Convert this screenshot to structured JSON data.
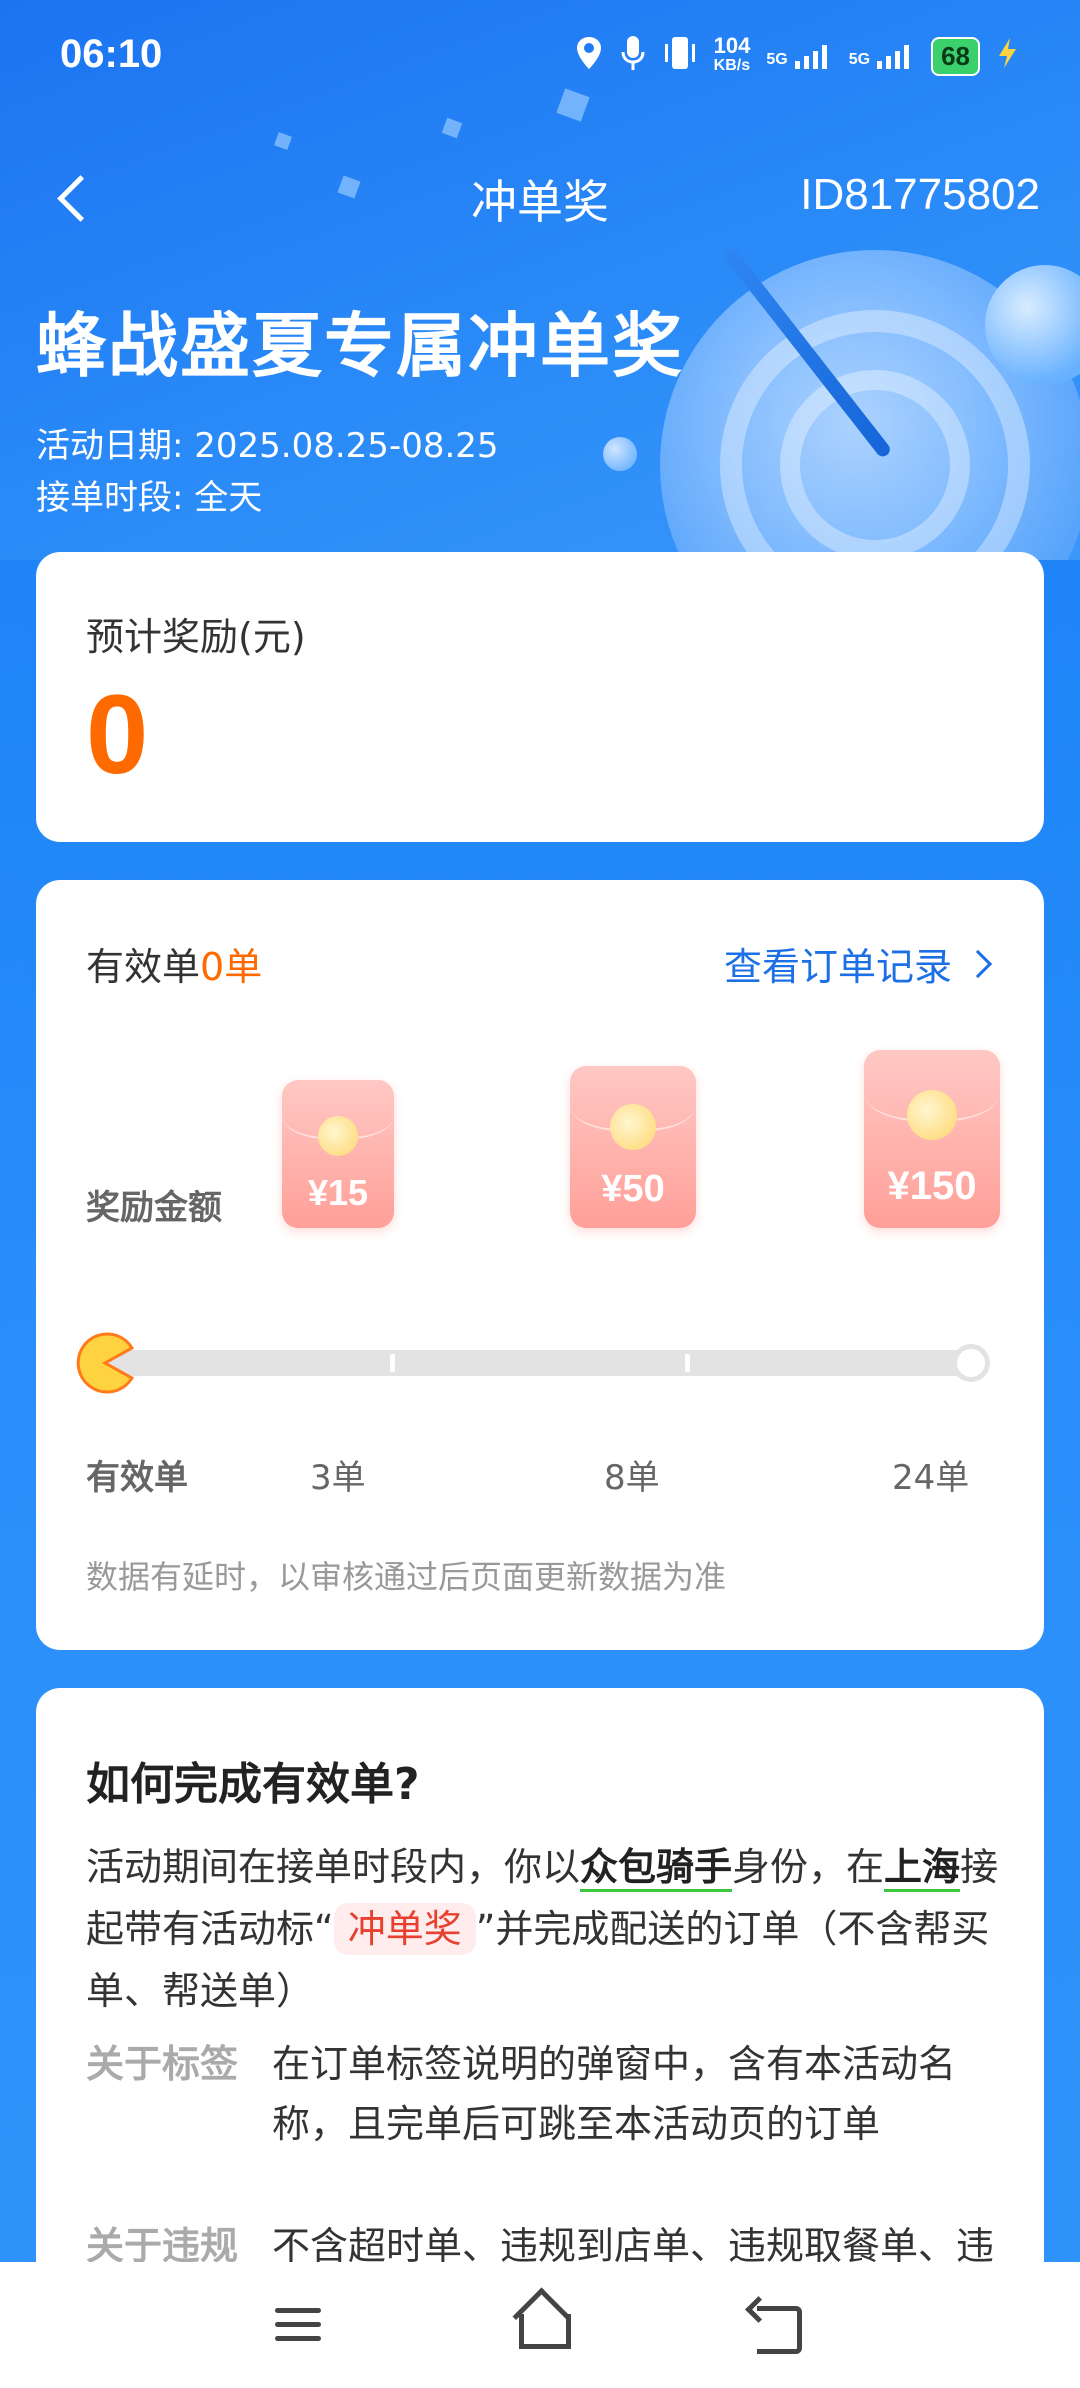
{
  "status_bar": {
    "time": "06:10",
    "net_speed": "104",
    "net_speed_unit": "KB/s",
    "signal1": "5G",
    "signal2": "5G",
    "battery": "68"
  },
  "nav": {
    "title": "冲单奖",
    "id": "ID81775802"
  },
  "hero": {
    "title": "蜂战盛夏专属冲单奖",
    "date_line": "活动日期: 2025.08.25-08.25",
    "time_line": "接单时段: 全天"
  },
  "reward": {
    "label": "预计奖励(元)",
    "value": "0"
  },
  "progress": {
    "valid_prefix": "有效单",
    "valid_count": "0单",
    "order_link": "查看订单记录",
    "reward_row_label": "奖励金额",
    "tiers": [
      {
        "amount": "¥15",
        "orders": "3单"
      },
      {
        "amount": "¥50",
        "orders": "8单"
      },
      {
        "amount": "¥150",
        "orders": "24单"
      }
    ],
    "current_progress": 0,
    "axis_row_label": "有效单",
    "note": "数据有延时，以审核通过后页面更新数据为准"
  },
  "howto": {
    "title": "如何完成有效单?",
    "p1": "活动期间在接单时段内，你以",
    "p1_hl1": "众包骑手",
    "p1_mid": "身份，在",
    "p1_hl2": "上海",
    "p1_mid2": "接起带有活动标“",
    "p1_tag": "冲单奖",
    "p1_end": "”并完成配送的订单（不含帮买单、帮送单）",
    "label_tag_key": "关于标签",
    "label_tag_val": "在订单标签说明的弹窗中，含有本活动名称，且完单后可跳至本活动页的订单",
    "violation_key": "关于违规",
    "violation_val": "不含超时单、违规到店单、违规取餐单、违规送达单等违规判责订单"
  },
  "colors": {
    "brand_blue": "#1f7cf4",
    "accent_orange": "#ff6a00",
    "link_blue": "#1d6fe6",
    "tag_red": "#e8402f"
  }
}
